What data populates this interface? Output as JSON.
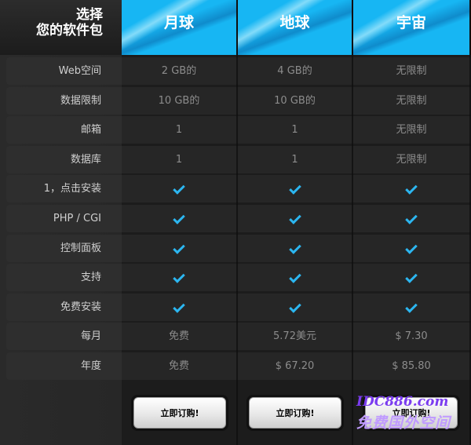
{
  "header": {
    "title_line1": "选择",
    "title_line2": "您的软件包",
    "plans": [
      "月球",
      "地球",
      "宇宙"
    ]
  },
  "rows": [
    {
      "label": "Web空间",
      "values": [
        "2 GB的",
        "4 GB的",
        "无限制"
      ]
    },
    {
      "label": "数据限制",
      "values": [
        "10 GB的",
        "10 GB的",
        "无限制"
      ]
    },
    {
      "label": "邮箱",
      "values": [
        "1",
        "1",
        "无限制"
      ]
    },
    {
      "label": "数据库",
      "values": [
        "1",
        "1",
        "无限制"
      ]
    },
    {
      "label": "1，点击安装",
      "values": [
        "check",
        "check",
        "check"
      ]
    },
    {
      "label": "PHP / CGI",
      "values": [
        "check",
        "check",
        "check"
      ]
    },
    {
      "label": "控制面板",
      "values": [
        "check",
        "check",
        "check"
      ]
    },
    {
      "label": "支持",
      "values": [
        "check",
        "check",
        "check"
      ]
    },
    {
      "label": "免费安装",
      "values": [
        "check",
        "check",
        "check"
      ]
    },
    {
      "label": "每月",
      "values": [
        "免费",
        "5.72美元",
        "$ 7.30"
      ]
    },
    {
      "label": "年度",
      "values": [
        "免费",
        "$ 67.20",
        "$ 85.80"
      ]
    }
  ],
  "buttons": {
    "order_label": "立即订购!"
  },
  "watermark": {
    "line1": "IDC886.com",
    "line2": "免费国外空间"
  },
  "colors": {
    "accent": "#17b6f3",
    "check": "#2cb6f0"
  }
}
